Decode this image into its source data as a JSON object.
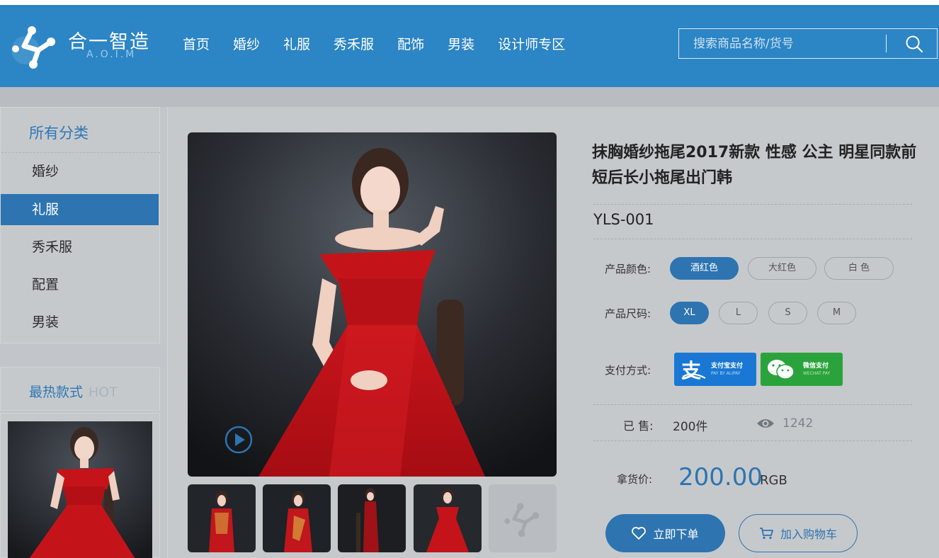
{
  "header": {
    "logo_text": "合一智造",
    "logo_sub": "A.O.I.M",
    "nav": [
      "首页",
      "婚纱",
      "礼服",
      "秀禾服",
      "配饰",
      "男装",
      "设计师专区"
    ],
    "search_placeholder": "搜索商品名称/货号",
    "icons": {
      "logo": "molecule-logo-icon",
      "search": "search-icon"
    }
  },
  "sidebar": {
    "title": "所有分类",
    "items": [
      {
        "label": "婚纱",
        "active": false
      },
      {
        "label": "礼服",
        "active": true
      },
      {
        "label": "秀禾服",
        "active": false
      },
      {
        "label": "配置",
        "active": false
      },
      {
        "label": "男装",
        "active": false
      }
    ],
    "hot_title": "最热款式",
    "hot_tag": "HOT"
  },
  "product": {
    "title": "抹胸婚纱拖尾2017新款 性感 公主 明星同款前短后长小拖尾出门韩",
    "sku": "YLS-001",
    "color_label": "产品颜色:",
    "colors": [
      "酒红色",
      "大红色",
      "白 色"
    ],
    "selected_color": "酒红色",
    "size_label": "产品尺码:",
    "sizes": [
      "XL",
      "L",
      "S",
      "M"
    ],
    "selected_size": "XL",
    "payment_label": "支付方式:",
    "payments": [
      {
        "name": "支付宝支付",
        "sub": "PAY BY ALIPAY",
        "icon": "alipay-icon"
      },
      {
        "name": "微信支付",
        "sub": "WECHAT PAY",
        "icon": "wechat-icon"
      }
    ],
    "sold_label": "已 售:",
    "sold_value": "200件",
    "views": "1242",
    "price_label": "拿货价:",
    "price": "200.00",
    "currency": "RGB",
    "buy_label": "立即下单",
    "cart_label": "加入购物车"
  },
  "colors": {
    "header": "#2c85c5",
    "accent": "#2d74b1",
    "dress": "#c4141a",
    "alipay": "#1a78d4",
    "wechat": "#2ba33c"
  }
}
